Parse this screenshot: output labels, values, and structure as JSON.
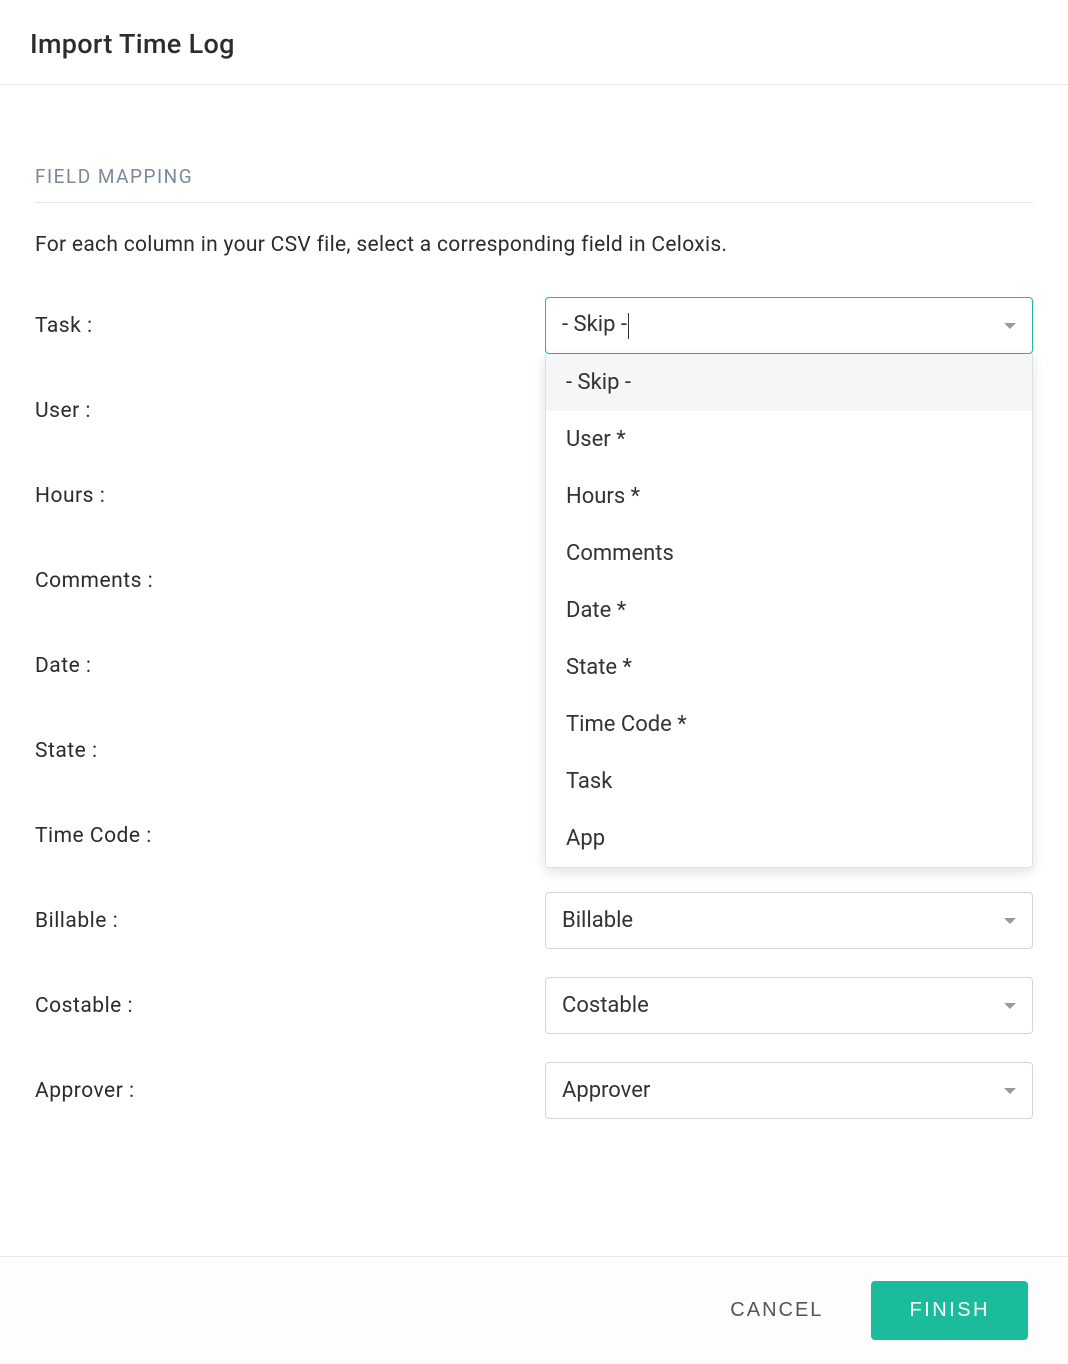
{
  "header": {
    "title": "Import Time Log"
  },
  "section": {
    "title": "FIELD MAPPING",
    "description": "For each column in your CSV file, select a corresponding field in Celoxis."
  },
  "fields": [
    {
      "label": "Task :",
      "value": "- Skip -",
      "open": true
    },
    {
      "label": "User :",
      "value": ""
    },
    {
      "label": "Hours :",
      "value": ""
    },
    {
      "label": "Comments :",
      "value": ""
    },
    {
      "label": "Date :",
      "value": ""
    },
    {
      "label": "State :",
      "value": ""
    },
    {
      "label": "Time Code :",
      "value": ""
    },
    {
      "label": "Billable :",
      "value": "Billable"
    },
    {
      "label": "Costable :",
      "value": "Costable"
    },
    {
      "label": "Approver :",
      "value": "Approver"
    }
  ],
  "dropdown": {
    "options": [
      "- Skip -",
      "User *",
      "Hours *",
      "Comments",
      "Date *",
      "State *",
      "Time Code *",
      "Task",
      "App"
    ]
  },
  "footer": {
    "cancel": "CANCEL",
    "finish": "FINISH"
  }
}
